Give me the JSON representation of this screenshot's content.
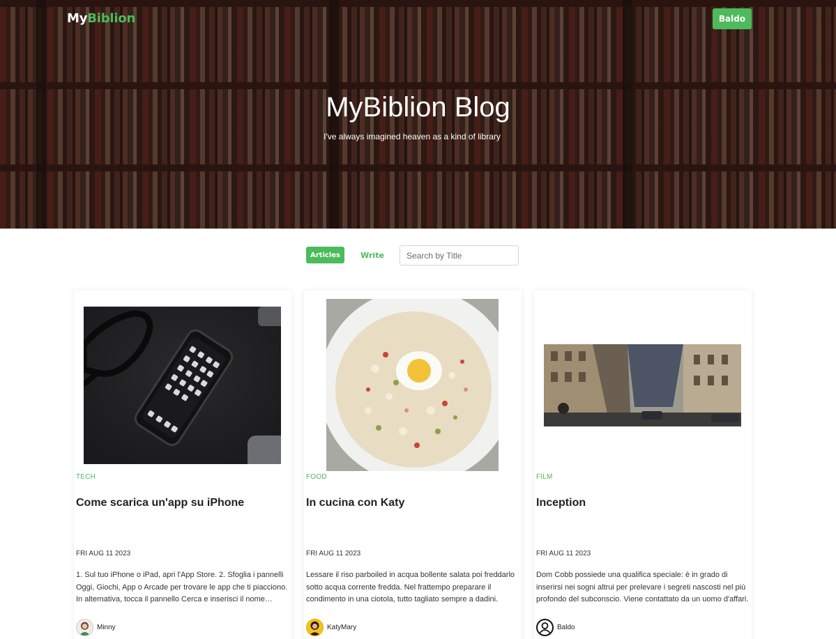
{
  "header": {
    "brand_prefix": "My",
    "brand_suffix": "Biblion",
    "user_label": "Baldo"
  },
  "hero": {
    "title": "MyBiblion Blog",
    "subtitle": "I've always imagined heaven as a kind of library"
  },
  "toolbar": {
    "articles_label": "Articles",
    "write_label": "Write",
    "search_placeholder": "Search by Title"
  },
  "colors": {
    "accent": "#4cbb5b",
    "text": "#222222"
  },
  "posts": [
    {
      "category": "TECH",
      "title": "Come scarica un'app su iPhone",
      "date": "FRI AUG 11 2023",
      "excerpt": "1. Sul tuo iPhone o iPad, apri l'App Store. 2. Sfoglia i pannelli Oggi, Giochi, App o Arcade per trovare le app che ti piacciono. In alternativa, tocca il pannello Cerca e inserisci il nome dell'app.",
      "author": "Minny",
      "image": "smartphone-and-glasses-photo"
    },
    {
      "category": "FOOD",
      "title": "In cucina con Katy",
      "date": "FRI AUG 11 2023",
      "excerpt": "Lessare il riso parboiled in acqua bollente salata poi freddarlo sotto acqua corrente fredda. Nel frattempo preparare il condimento in una ciotola, tutto tagliato sempre a dadini.",
      "author": "KatyMary",
      "image": "rice-salad-photo"
    },
    {
      "category": "FILM",
      "title": "Inception",
      "date": "FRI AUG 11 2023",
      "excerpt": "Dom Cobb possiede una qualifica speciale: è in grado di inserirsi nei sogni altrui per prelevare i segreti nascosti nel più profondo del subconscio. Viene contattato da un uomo d'affari.",
      "author": "Baldo",
      "image": "folding-city-street-photo"
    }
  ]
}
